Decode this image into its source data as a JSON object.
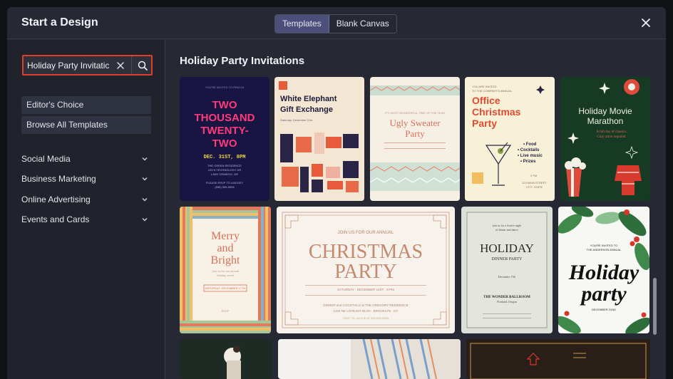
{
  "header": {
    "title": "Start a Design",
    "tabs": [
      "Templates",
      "Blank Canvas"
    ],
    "active_tab": "Templates"
  },
  "search": {
    "value": "Holiday Party Invitatic",
    "clear_icon": "close-icon",
    "search_icon": "search-icon"
  },
  "sidebar": {
    "buttons": [
      "Editor's Choice",
      "Browse All Templates"
    ],
    "categories": [
      "Social Media",
      "Business Marketing",
      "Online Advertising",
      "Events and Cards"
    ]
  },
  "main": {
    "title": "Holiday Party Invitations",
    "cards": [
      {
        "name": "two-thousand-twenty-two",
        "lines": [
          "YOU'RE INVITED TO RING IN",
          "TWO",
          "THOUSAND",
          "TWENTY-",
          "TWO",
          "DEC. 31ST, 8PM",
          "THE GREEN RESIDENCE",
          "123 N TECHNOLOGY DR",
          "LAKE OSWEGO, OR",
          "PLEASE RSVP TO LINDSEY",
          "(555) 555-5555"
        ]
      },
      {
        "name": "white-elephant",
        "lines": [
          "White Elephant",
          "Gift Exchange",
          "Saturday, December 21st"
        ]
      },
      {
        "name": "ugly-sweater",
        "lines": [
          "Ugly Sweater",
          "Party",
          "IT'S MOST WONDERFUL TIME OF THE YEAR"
        ]
      },
      {
        "name": "office-christmas",
        "lines": [
          "YOU ARE INVITED",
          "TO THE COMPANY'S ANNUAL",
          "Office",
          "Christmas",
          "Party",
          "• Food",
          "• Cocktails",
          "• Live music",
          "• Prizes",
          "2 PM",
          "123 MAIN STREET",
          "CITY, STATE"
        ]
      },
      {
        "name": "holiday-movie",
        "lines": [
          "Holiday Movie",
          "Marathon",
          "A full day of classics,",
          "Cozy attire required."
        ]
      },
      {
        "name": "merry-bright",
        "lines": [
          "Merry",
          "and",
          "Bright",
          "Join us for our annual",
          "Holiday event",
          "SATURDAY, DECEMBER 17TH",
          "RSVP"
        ]
      },
      {
        "name": "christmas-party",
        "lines": [
          "JOIN US FOR OUR ANNUAL",
          "CHRISTMAS",
          "PARTY",
          "SATURDAY · DECEMBER 14ST · 8 PM",
          "DINNER and COCKTAILS at THE GREGORY RESIDENCE",
          "1234 NE LOVEJOY BLVD · BROOKLYN · NY",
          "RSVP TO JACKIE AT 555-555-5555"
        ]
      },
      {
        "name": "holiday-dinner",
        "lines": [
          "join us for a festive night",
          "of dinner and dance",
          "HOLIDAY",
          "DINNER PARTY",
          "December 17th",
          "THE WONDER BALLROOM",
          "Portland, Oregon"
        ]
      },
      {
        "name": "holiday-party-script",
        "lines": [
          "YOU'RE INVITED TO",
          "THE ANDERSON ANNUAL",
          "Holiday",
          "party",
          "DECEMBER 22ND"
        ]
      }
    ]
  },
  "colors": {
    "accent": "#e0402a",
    "active_tab": "#4c4f7a",
    "modal": "#262834",
    "sidebar": "#20222c"
  }
}
